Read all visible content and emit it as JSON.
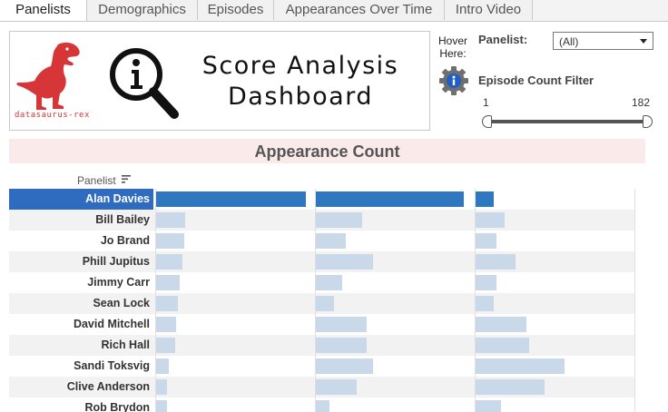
{
  "tabs": [
    "Panelists",
    "Demographics",
    "Episodes",
    "Appearances Over Time",
    "Intro Video"
  ],
  "active_tab": 0,
  "header": {
    "brand": "datasaurus-rex",
    "title_line1": "Score Analysis",
    "title_line2": "Dashboard"
  },
  "controls": {
    "hover_line1": "Hover",
    "hover_line2": "Here:",
    "panelist_label": "Panelist:",
    "panelist_value": "(All)",
    "episode_filter_label": "Episode Count Filter",
    "range_min": "1",
    "range_max": "182"
  },
  "section_title": "Appearance Count",
  "column_header": "Panelist",
  "colors": {
    "selected_bar": "#2f78c0",
    "bar": "#c9d9ea",
    "selected_row": "#2f6bbf",
    "band": "#fbeaea"
  },
  "chart_data": {
    "type": "bar",
    "categories": [
      "Alan Davies",
      "Bill Bailey",
      "Jo Brand",
      "Phill Jupitus",
      "Jimmy Carr",
      "Sean Lock",
      "David Mitchell",
      "Rich Hall",
      "Sandi Toksvig",
      "Clive Anderson",
      "Rob Brydon"
    ],
    "selected": "Alan Davies",
    "panels": [
      {
        "values": [
          1.0,
          0.2,
          0.19,
          0.18,
          0.16,
          0.15,
          0.14,
          0.13,
          0.09,
          0.08,
          0.08
        ]
      },
      {
        "values": [
          1.0,
          0.32,
          0.21,
          0.39,
          0.18,
          0.13,
          0.35,
          0.35,
          0.39,
          0.28,
          0.1
        ]
      },
      {
        "values": [
          0.14,
          0.22,
          0.16,
          0.3,
          0.16,
          0.14,
          0.38,
          0.4,
          0.66,
          0.51,
          0.19
        ]
      }
    ]
  }
}
